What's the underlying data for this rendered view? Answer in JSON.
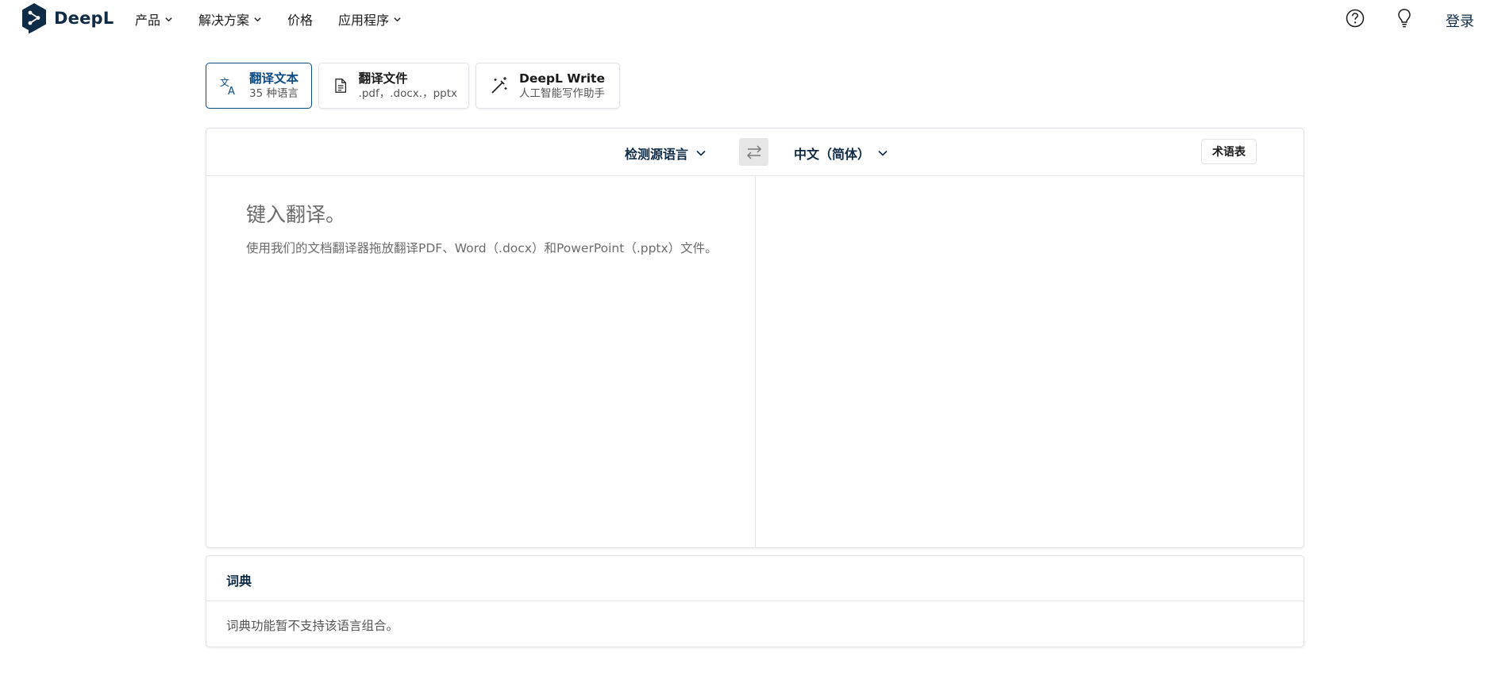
{
  "header": {
    "logo_text": "DeepL",
    "nav": [
      {
        "label": "产品",
        "has_dropdown": true
      },
      {
        "label": "解决方案",
        "has_dropdown": true
      },
      {
        "label": "价格",
        "has_dropdown": false
      },
      {
        "label": "应用程序",
        "has_dropdown": true
      }
    ],
    "icons": [
      "help-icon",
      "lightbulb-icon"
    ],
    "login_label": "登录"
  },
  "modes": [
    {
      "title": "翻译文本",
      "subtitle": "35 种语言",
      "icon": "translate-icon",
      "active": true
    },
    {
      "title": "翻译文件",
      "subtitle": ".pdf，.docx.，pptx",
      "icon": "document-icon",
      "active": false
    },
    {
      "title": "DeepL Write",
      "subtitle": "人工智能写作助手",
      "icon": "magic-wand-icon",
      "active": false
    }
  ],
  "translator": {
    "source_language": "检测源语言",
    "target_language": "中文（简体）",
    "swap_icon": "swap-arrows-icon",
    "glossary_label": "术语表",
    "source_placeholder": "键入翻译。",
    "source_hint": "使用我们的文档翻译器拖放翻译PDF、Word（.docx）和PowerPoint（.pptx）文件。",
    "target_text": ""
  },
  "dictionary": {
    "title": "词典",
    "message": "词典功能暂不支持该语言组合。"
  },
  "colors": {
    "brand_navy": "#0f2b46",
    "active_blue": "#0f4c81",
    "border": "#dfe2e6",
    "swap_bg": "#e6e6e6"
  }
}
